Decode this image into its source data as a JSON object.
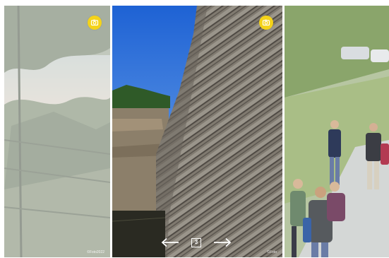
{
  "carousel": {
    "current_page": "3",
    "panels": [
      {
        "role": "previous",
        "icon": "camera-icon",
        "credit": "©Foto2022"
      },
      {
        "role": "current",
        "icon": "camera-icon",
        "credit": "©Foto"
      },
      {
        "role": "next"
      }
    ],
    "navigation": {
      "prev_icon": "arrow-left-icon",
      "next_icon": "arrow-right-icon"
    },
    "colors": {
      "badge": "#f4d31a",
      "sky": "#2f6fd6",
      "rock": "#7a766e",
      "foliage": "#4f6b3a"
    }
  }
}
